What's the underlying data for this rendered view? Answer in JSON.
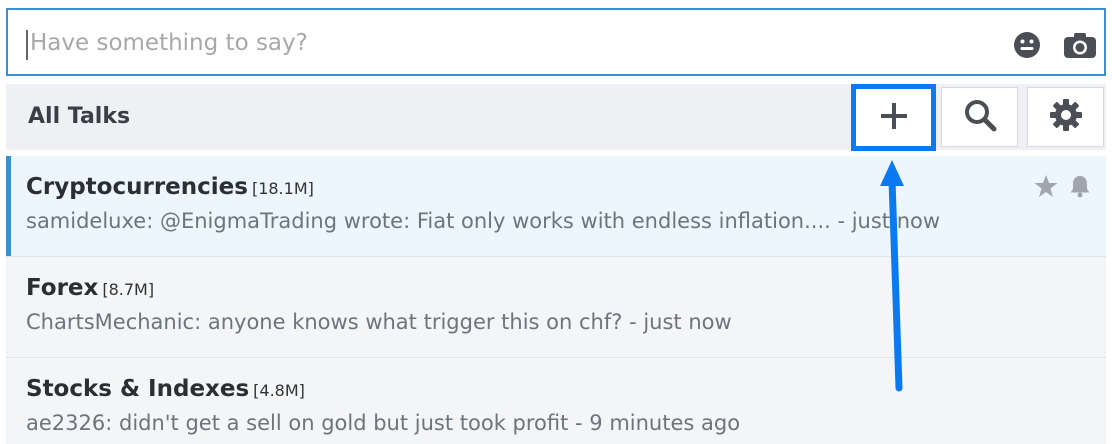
{
  "composer": {
    "placeholder": "Have something to say?",
    "value": "",
    "icons": [
      "emoji-icon",
      "camera-icon"
    ]
  },
  "toolbar": {
    "title": "All Talks",
    "buttons": [
      {
        "name": "add-talk-button",
        "icon": "plus-icon",
        "highlighted": true
      },
      {
        "name": "search-button",
        "icon": "search-icon"
      },
      {
        "name": "settings-button",
        "icon": "gear-icon"
      }
    ]
  },
  "talks": [
    {
      "name": "Cryptocurrencies",
      "count": "[18.1M]",
      "preview": "samideluxe: @EnigmaTrading wrote: Fiat only works with endless inflation.... - just now",
      "active": true,
      "icons": [
        "star-icon",
        "bell-icon"
      ]
    },
    {
      "name": "Forex",
      "count": "[8.7M]",
      "preview": "ChartsMechanic: anyone knows what trigger this on chf? - just now",
      "active": false
    },
    {
      "name": "Stocks & Indexes",
      "count": "[4.8M]",
      "preview": "ae2326: didn't get a sell on gold but just took profit - 9 minutes ago",
      "active": false
    }
  ],
  "colors": {
    "accent": "#3b8fd0",
    "highlight": "#0b7af0",
    "toolbar_bg": "#eef0f3",
    "active_row_bg": "#edf5fd"
  },
  "annotation": {
    "type": "arrow-up",
    "target": "add-talk-button",
    "color": "#0b7af0"
  }
}
